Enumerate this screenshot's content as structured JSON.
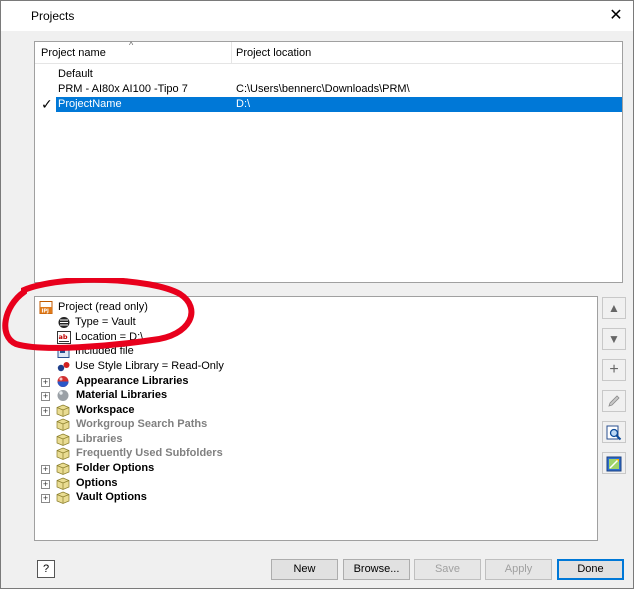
{
  "window": {
    "title": "Projects",
    "close_glyph": "✕"
  },
  "projects": {
    "columns": {
      "name": "Project name",
      "location": "Project location"
    },
    "sort_indicator": "^",
    "rows": [
      {
        "name": "Default",
        "location": ""
      },
      {
        "name": "PRM - AI80x AI100 -Tipo 7",
        "location": "C:\\Users\\bennerc\\Downloads\\PRM\\"
      },
      {
        "name": "ProjectName",
        "location": "D:\\",
        "active": true,
        "selected": true
      }
    ],
    "active_mark": "✓"
  },
  "tree": {
    "root": "Project (read only)",
    "children": [
      {
        "label": "Type = Vault",
        "icon": "vault-type-icon"
      },
      {
        "label": "Location = D:\\",
        "icon": "text-field-icon"
      },
      {
        "label": "Included file",
        "icon": "included-file-icon"
      }
    ],
    "use_style": "Use Style Library = Read-Only",
    "sections": [
      {
        "label": "Appearance Libraries",
        "expandable": true,
        "enabled": true,
        "icon": "appearance-sphere-icon"
      },
      {
        "label": "Material Libraries",
        "expandable": true,
        "enabled": true,
        "icon": "material-sphere-icon"
      },
      {
        "label": "Workspace",
        "expandable": true,
        "enabled": true,
        "icon": "cube-icon"
      },
      {
        "label": "Workgroup Search Paths",
        "expandable": false,
        "enabled": false,
        "icon": "cube-icon"
      },
      {
        "label": "Libraries",
        "expandable": false,
        "enabled": false,
        "icon": "cube-icon"
      },
      {
        "label": "Frequently Used Subfolders",
        "expandable": false,
        "enabled": false,
        "icon": "cube-icon"
      },
      {
        "label": "Folder Options",
        "expandable": true,
        "enabled": true,
        "icon": "cube-icon"
      },
      {
        "label": "Options",
        "expandable": true,
        "enabled": true,
        "icon": "cube-icon"
      },
      {
        "label": "Vault Options",
        "expandable": true,
        "enabled": true,
        "icon": "cube-icon"
      }
    ]
  },
  "side_buttons": {
    "up": "▲",
    "down": "▼",
    "add": "+"
  },
  "buttons": {
    "help": "?",
    "new": "New",
    "browse": "Browse...",
    "save": "Save",
    "apply": "Apply",
    "done": "Done"
  },
  "colors": {
    "selection": "#0078d7",
    "annotation": "#e8001c"
  }
}
